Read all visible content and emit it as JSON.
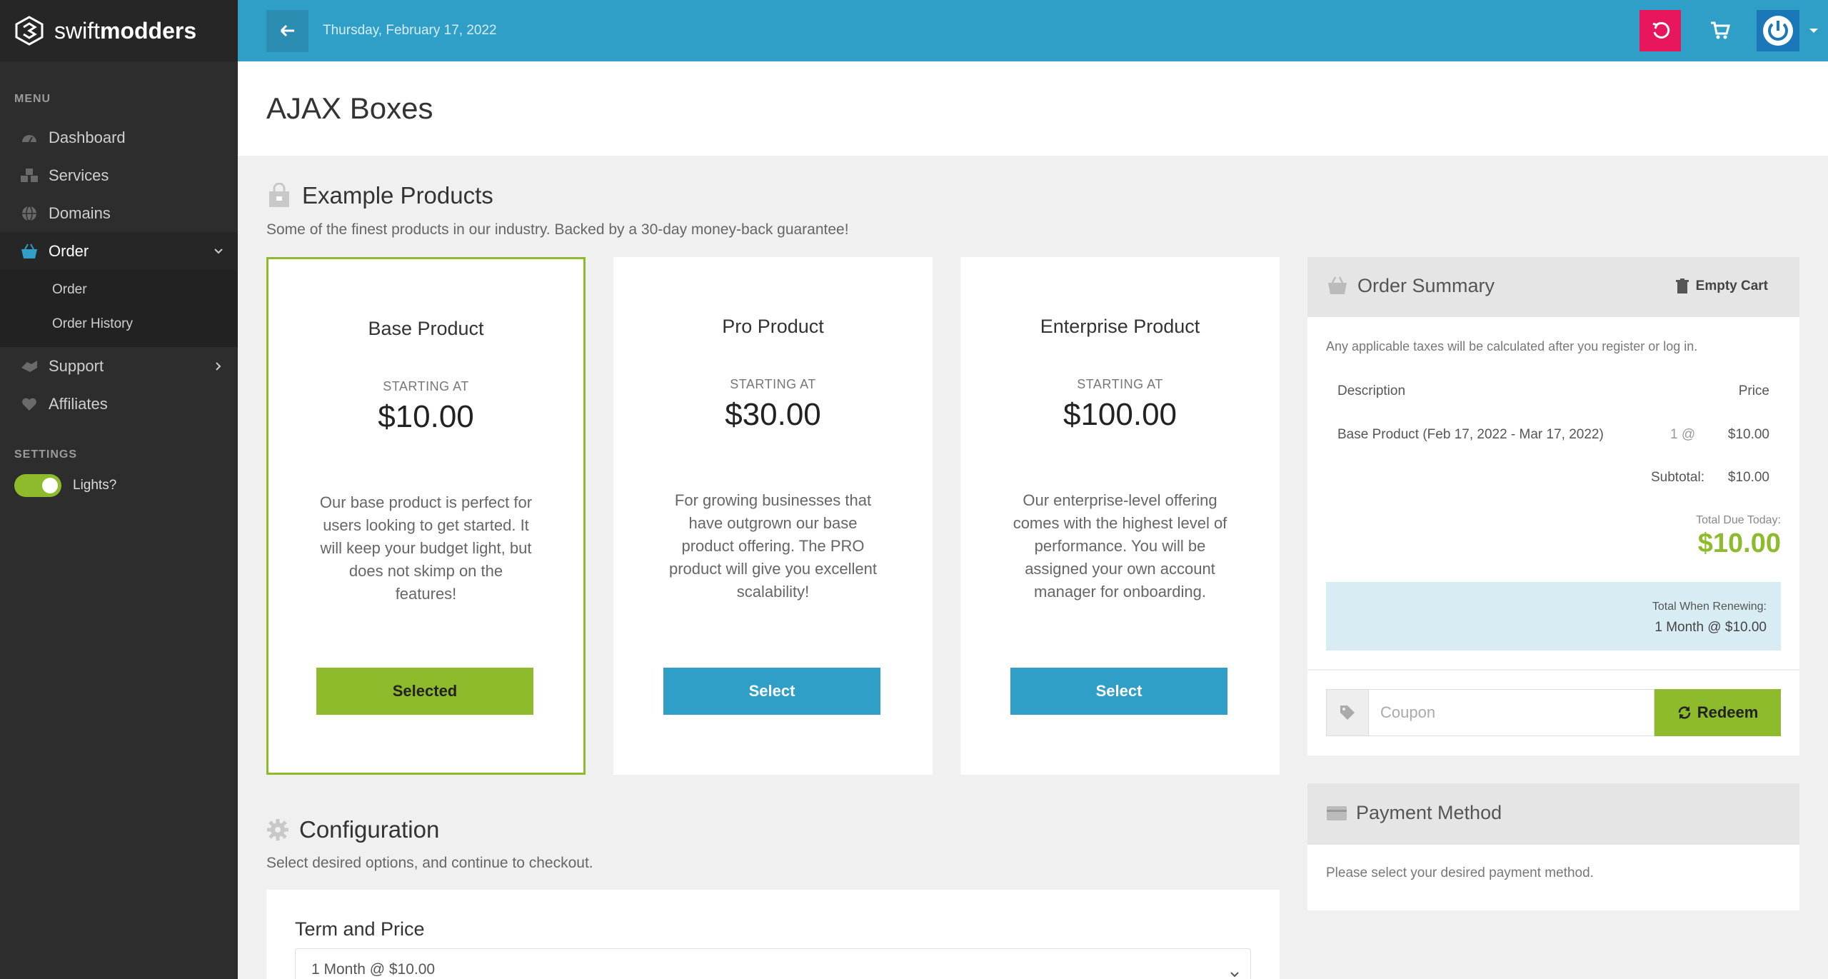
{
  "brand": {
    "part1": "swift",
    "part2": "modders"
  },
  "sidebar": {
    "menu_header": "MENU",
    "items": [
      {
        "label": "Dashboard",
        "icon": "dashboard-icon"
      },
      {
        "label": "Services",
        "icon": "cubes-icon"
      },
      {
        "label": "Domains",
        "icon": "globe-icon"
      },
      {
        "label": "Order",
        "icon": "basket-icon"
      },
      {
        "label": "Support",
        "icon": "support-icon"
      },
      {
        "label": "Affiliates",
        "icon": "heart-icon"
      }
    ],
    "order_sub": [
      "Order",
      "Order History"
    ],
    "settings_header": "SETTINGS",
    "lights_label": "Lights?"
  },
  "topbar": {
    "date": "Thursday, February 17, 2022"
  },
  "page": {
    "title": "AJAX Boxes"
  },
  "products_section": {
    "title": "Example Products",
    "subtitle": "Some of the finest products in our industry. Backed by a 30-day money-back guarantee!",
    "products": [
      {
        "name": "Base Product",
        "starting": "STARTING AT",
        "price": "$10.00",
        "desc": "Our base product is perfect for users looking to get started. It will keep your budget light, but does not skimp on the features!",
        "button": "Selected"
      },
      {
        "name": "Pro Product",
        "starting": "STARTING AT",
        "price": "$30.00",
        "desc": "For growing businesses that have outgrown our base product offering. The PRO product will give you excellent scalability!",
        "button": "Select"
      },
      {
        "name": "Enterprise Product",
        "starting": "STARTING AT",
        "price": "$100.00",
        "desc": "Our enterprise-level offering comes with the highest level of performance. You will be assigned your own account manager for onboarding.",
        "button": "Select"
      }
    ]
  },
  "summary": {
    "title": "Order Summary",
    "empty_cart": "Empty Cart",
    "tax_note": "Any applicable taxes will be calculated after you register or log in.",
    "col_desc": "Description",
    "col_price": "Price",
    "line_desc": "Base Product (Feb 17, 2022 - Mar 17, 2022)",
    "line_qty": "1 @",
    "line_price": "$10.00",
    "subtotal_label": "Subtotal:",
    "subtotal_value": "$10.00",
    "total_label": "Total Due Today:",
    "total_value": "$10.00",
    "renew_label": "Total When Renewing:",
    "renew_value": "1 Month @ $10.00",
    "coupon_placeholder": "Coupon",
    "redeem": "Redeem"
  },
  "payment": {
    "title": "Payment Method",
    "note": "Please select your desired payment method."
  },
  "config": {
    "title": "Configuration",
    "subtitle": "Select desired options, and continue to checkout.",
    "term_label": "Term and Price",
    "term_value": "1 Month @ $10.00"
  },
  "colors": {
    "accent_blue": "#2f9fc7",
    "accent_green": "#8dbb2b",
    "undo_pink": "#e8175d"
  }
}
